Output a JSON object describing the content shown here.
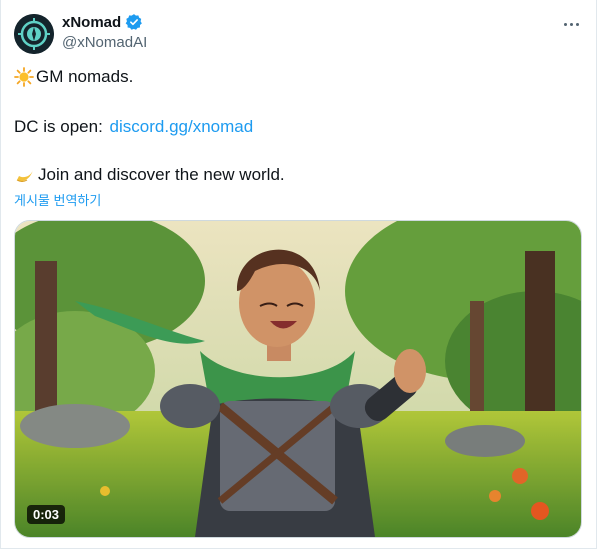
{
  "author": {
    "display_name": "xNomad",
    "handle": "@xNomadAI",
    "verified_icon": "verified-badge-icon"
  },
  "tweet": {
    "line1": "GM nomads.",
    "line2_prefix": "DC is open: ",
    "line2_link": "discord.gg/xnomad",
    "line3": "Join and discover the new world.",
    "translate": "게시물 번역하기"
  },
  "media": {
    "video_time": "0:03"
  },
  "colors": {
    "link": "#1d9bf0",
    "muted": "#536471",
    "text": "#0f1419"
  }
}
